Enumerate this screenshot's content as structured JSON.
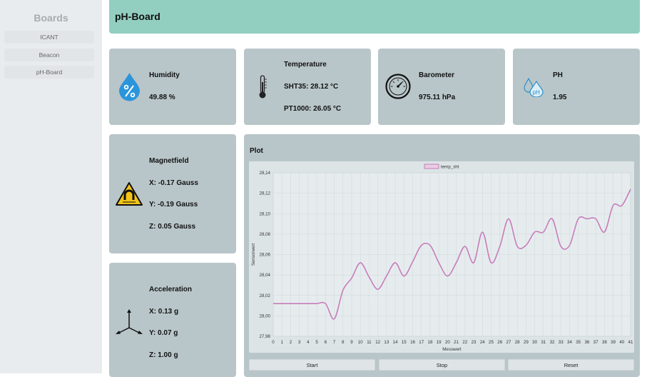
{
  "sidebar": {
    "title": "Boards",
    "items": [
      {
        "label": "ICANT"
      },
      {
        "label": "Beacon"
      },
      {
        "label": "pH-Board"
      }
    ]
  },
  "header": {
    "title": "pH-Board"
  },
  "cards": {
    "humidity": {
      "title": "Humidity",
      "value": "49.88 %"
    },
    "temperature": {
      "title": "Temperature",
      "sht35": "SHT35: 28.12 °C",
      "pt1000": "PT1000: 26.05 °C"
    },
    "barometer": {
      "title": "Barometer",
      "value": "975.11 hPa"
    },
    "ph": {
      "title": "PH",
      "value": "1.95"
    },
    "magnetfield": {
      "title": "Magnetfield",
      "x": "X: -0.17 Gauss",
      "y": "Y: -0.19 Gauss",
      "z": "Z: 0.05 Gauss"
    },
    "acceleration": {
      "title": "Acceleration",
      "x": "X: 0.13 g",
      "y": "Y: 0.07 g",
      "z": "Z: 1.00 g"
    }
  },
  "plot": {
    "title": "Plot",
    "buttons": {
      "start": "Start",
      "stop": "Stop",
      "reset": "Reset"
    }
  },
  "colors": {
    "header": "#92cfc1",
    "card": "#b9c6c9",
    "series": "#c77dbb",
    "water_icon": "#2b95dc"
  },
  "chart_data": {
    "type": "line",
    "title": "",
    "xlabel": "Messwert",
    "ylabel": "Sensorwert",
    "ylim": [
      27.98,
      28.14
    ],
    "yticks": [
      "27,98",
      "28,00",
      "28,02",
      "28,04",
      "28,06",
      "28,08",
      "28,10",
      "28,12",
      "28,14"
    ],
    "x": [
      0,
      1,
      2,
      3,
      4,
      5,
      6,
      7,
      8,
      9,
      10,
      11,
      12,
      13,
      14,
      15,
      16,
      17,
      18,
      19,
      20,
      21,
      22,
      23,
      24,
      25,
      26,
      27,
      28,
      29,
      30,
      31,
      32,
      33,
      34,
      35,
      36,
      37,
      38,
      39,
      40,
      41
    ],
    "legend_position": "top-center",
    "grid": true,
    "series": [
      {
        "name": "temp_sht",
        "color": "#c77dbb",
        "values": [
          28.012,
          28.012,
          28.012,
          28.012,
          28.012,
          28.012,
          28.012,
          27.997,
          28.025,
          28.037,
          28.052,
          28.038,
          28.026,
          28.039,
          28.052,
          28.039,
          28.053,
          28.069,
          28.069,
          28.052,
          28.039,
          28.052,
          28.068,
          28.052,
          28.082,
          28.052,
          28.068,
          28.095,
          28.068,
          28.069,
          28.082,
          28.082,
          28.095,
          28.068,
          28.069,
          28.095,
          28.095,
          28.095,
          28.082,
          28.108,
          28.108,
          28.124
        ]
      }
    ]
  }
}
